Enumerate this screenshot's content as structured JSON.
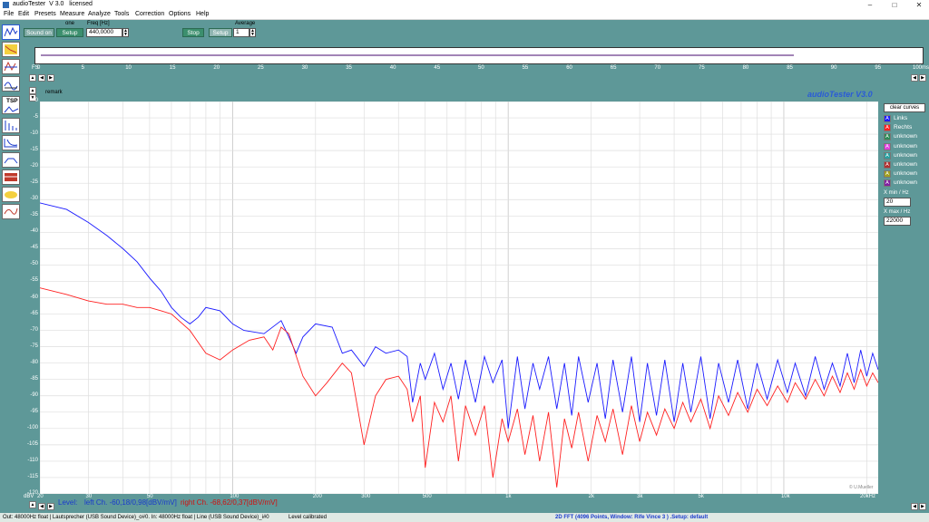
{
  "window": {
    "title": "audioTester  V 3.0   licensed"
  },
  "titlebar_buttons": [
    "–",
    "□",
    "✕"
  ],
  "menu": [
    "File",
    "Edit",
    "Presets",
    "Measure",
    "Analyze",
    "Tools",
    "Correction",
    "Options",
    "Help"
  ],
  "toolbar": {
    "sound_on_label": "Sound on",
    "setup1_label": "Setup",
    "one_label": "one",
    "freq_label": "Freq [Hz]",
    "freq_value": "440,0000",
    "stop_label": "Stop",
    "setup2_label": "Setup",
    "average_label": "Average",
    "average_value": "1"
  },
  "sidebar_icons": [
    "oscilloscope-icon",
    "fft-icon",
    "spectrum-icon",
    "waterfall-icon",
    "sweep-icon",
    "tsp-icon",
    "distortion-icon",
    "impulse-icon",
    "filter-icon",
    "cone-icon",
    "phase-icon"
  ],
  "tsp_label": "TSP",
  "overview": {
    "start_label": "FS",
    "end_label": "100ms",
    "ticks": [
      "0",
      "5",
      "10",
      "15",
      "20",
      "25",
      "30",
      "35",
      "40",
      "45",
      "50",
      "55",
      "60",
      "65",
      "70",
      "75",
      "80",
      "85",
      "90",
      "95"
    ]
  },
  "remark_label": "remark",
  "brand_label": "audioTester  V3.0",
  "copyright_label": "© U.Mueller",
  "legend": {
    "clear_label": "clear curves",
    "items": [
      {
        "letter": "A",
        "label": "Links",
        "color": "#1a1aff"
      },
      {
        "letter": "A",
        "label": "Rechts",
        "color": "#ff2020"
      },
      {
        "letter": "A",
        "label": "unknown",
        "color": "#2e8b57"
      },
      {
        "letter": "A",
        "label": "unknown",
        "color": "#e040e0"
      },
      {
        "letter": "A",
        "label": "unknown",
        "color": "#2aa0a0"
      },
      {
        "letter": "A",
        "label": "unknown",
        "color": "#b03030"
      },
      {
        "letter": "A",
        "label": "unknown",
        "color": "#a0a020"
      },
      {
        "letter": "A",
        "label": "unknown",
        "color": "#8020a0"
      }
    ],
    "xmin_label": "X min / Hz",
    "xmin_value": "20",
    "xmax_label": "X max / Hz",
    "xmax_value": "22000"
  },
  "level": {
    "label": "Level:",
    "left": "left Ch. -60,18/0,98[dBV/mV]",
    "right": "right Ch. -68,62/0,37[dBV/mV]"
  },
  "status": {
    "left": "Out: 48000Hz float  | Lautsprecher (USB Sound Device)_o#0. In: 48000Hz float  | Line (USB Sound Device)_i#0",
    "calibrated": "Level calibrated",
    "center": "2D FFT (4096 Points, Window: Rife Vince 3 )  .Setup:  default"
  },
  "chart_data": {
    "type": "line",
    "yunit": "dBV",
    "xunit": "Hz",
    "xscale": "log",
    "xlim": [
      20,
      22000
    ],
    "ylim": [
      -120,
      0
    ],
    "y_ticks": [
      "0",
      "-5",
      "-10",
      "-15",
      "-20",
      "-25",
      "-30",
      "-35",
      "-40",
      "-45",
      "-50",
      "-55",
      "-60",
      "-65",
      "-70",
      "-75",
      "-80",
      "-85",
      "-90",
      "-95",
      "-100",
      "-105",
      "-110",
      "-115",
      "-120"
    ],
    "x_ticks": [
      {
        "value": 20,
        "label": "20"
      },
      {
        "value": 30,
        "label": "30"
      },
      {
        "value": 50,
        "label": "50"
      },
      {
        "value": 100,
        "label": "100"
      },
      {
        "value": 200,
        "label": "200"
      },
      {
        "value": 300,
        "label": "300"
      },
      {
        "value": 500,
        "label": "500"
      },
      {
        "value": 1000,
        "label": "1k"
      },
      {
        "value": 2000,
        "label": "2k"
      },
      {
        "value": 3000,
        "label": "3k"
      },
      {
        "value": 5000,
        "label": "5k"
      },
      {
        "value": 10000,
        "label": "10k"
      },
      {
        "value": 20000,
        "label": "20kHz"
      }
    ],
    "y_axis_label": "dBV",
    "grid": true,
    "series": [
      {
        "name": "Links",
        "color": "#1a1aff",
        "points": [
          [
            20,
            -31
          ],
          [
            25,
            -33
          ],
          [
            30,
            -37
          ],
          [
            35,
            -41
          ],
          [
            40,
            -45
          ],
          [
            45,
            -49
          ],
          [
            50,
            -54
          ],
          [
            55,
            -58
          ],
          [
            60,
            -63
          ],
          [
            65,
            -66
          ],
          [
            70,
            -68
          ],
          [
            75,
            -66
          ],
          [
            80,
            -63
          ],
          [
            90,
            -64
          ],
          [
            100,
            -68
          ],
          [
            110,
            -70
          ],
          [
            130,
            -71
          ],
          [
            150,
            -67
          ],
          [
            160,
            -72
          ],
          [
            170,
            -77
          ],
          [
            180,
            -72
          ],
          [
            200,
            -68
          ],
          [
            230,
            -69
          ],
          [
            250,
            -77
          ],
          [
            270,
            -76
          ],
          [
            300,
            -81
          ],
          [
            330,
            -75
          ],
          [
            360,
            -77
          ],
          [
            400,
            -76
          ],
          [
            430,
            -78
          ],
          [
            450,
            -92
          ],
          [
            480,
            -80
          ],
          [
            500,
            -85
          ],
          [
            540,
            -77
          ],
          [
            580,
            -88
          ],
          [
            620,
            -80
          ],
          [
            660,
            -91
          ],
          [
            700,
            -79
          ],
          [
            760,
            -92
          ],
          [
            820,
            -78
          ],
          [
            880,
            -86
          ],
          [
            950,
            -79
          ],
          [
            1000,
            -100
          ],
          [
            1080,
            -78
          ],
          [
            1150,
            -94
          ],
          [
            1230,
            -80
          ],
          [
            1300,
            -88
          ],
          [
            1400,
            -78
          ],
          [
            1500,
            -94
          ],
          [
            1600,
            -80
          ],
          [
            1700,
            -96
          ],
          [
            1800,
            -78
          ],
          [
            1950,
            -92
          ],
          [
            2100,
            -80
          ],
          [
            2250,
            -97
          ],
          [
            2400,
            -79
          ],
          [
            2600,
            -95
          ],
          [
            2800,
            -78
          ],
          [
            3000,
            -98
          ],
          [
            3200,
            -80
          ],
          [
            3450,
            -96
          ],
          [
            3700,
            -79
          ],
          [
            4000,
            -98
          ],
          [
            4300,
            -80
          ],
          [
            4600,
            -95
          ],
          [
            5000,
            -78
          ],
          [
            5400,
            -97
          ],
          [
            5800,
            -80
          ],
          [
            6300,
            -92
          ],
          [
            6800,
            -79
          ],
          [
            7400,
            -94
          ],
          [
            8000,
            -80
          ],
          [
            8700,
            -91
          ],
          [
            9500,
            -79
          ],
          [
            10300,
            -89
          ],
          [
            11000,
            -80
          ],
          [
            12000,
            -90
          ],
          [
            13000,
            -78
          ],
          [
            14000,
            -88
          ],
          [
            15000,
            -80
          ],
          [
            16000,
            -87
          ],
          [
            17000,
            -77
          ],
          [
            18000,
            -86
          ],
          [
            19000,
            -76
          ],
          [
            20000,
            -84
          ],
          [
            21000,
            -77
          ],
          [
            22000,
            -82
          ]
        ]
      },
      {
        "name": "Rechts",
        "color": "#ff2020",
        "points": [
          [
            20,
            -57
          ],
          [
            25,
            -59
          ],
          [
            30,
            -61
          ],
          [
            35,
            -62
          ],
          [
            40,
            -62
          ],
          [
            45,
            -63
          ],
          [
            50,
            -63
          ],
          [
            55,
            -64
          ],
          [
            60,
            -65
          ],
          [
            70,
            -70
          ],
          [
            80,
            -77
          ],
          [
            90,
            -79
          ],
          [
            100,
            -76
          ],
          [
            115,
            -73
          ],
          [
            130,
            -72
          ],
          [
            140,
            -76
          ],
          [
            150,
            -69
          ],
          [
            160,
            -71
          ],
          [
            180,
            -84
          ],
          [
            200,
            -90
          ],
          [
            220,
            -86
          ],
          [
            250,
            -80
          ],
          [
            270,
            -83
          ],
          [
            300,
            -105
          ],
          [
            330,
            -90
          ],
          [
            360,
            -85
          ],
          [
            400,
            -84
          ],
          [
            430,
            -88
          ],
          [
            450,
            -98
          ],
          [
            480,
            -90
          ],
          [
            500,
            -112
          ],
          [
            540,
            -92
          ],
          [
            580,
            -98
          ],
          [
            620,
            -90
          ],
          [
            660,
            -110
          ],
          [
            700,
            -93
          ],
          [
            760,
            -102
          ],
          [
            820,
            -93
          ],
          [
            880,
            -115
          ],
          [
            950,
            -97
          ],
          [
            1000,
            -104
          ],
          [
            1080,
            -94
          ],
          [
            1150,
            -108
          ],
          [
            1230,
            -96
          ],
          [
            1300,
            -110
          ],
          [
            1400,
            -95
          ],
          [
            1500,
            -118
          ],
          [
            1600,
            -97
          ],
          [
            1700,
            -106
          ],
          [
            1800,
            -95
          ],
          [
            1950,
            -110
          ],
          [
            2100,
            -96
          ],
          [
            2250,
            -104
          ],
          [
            2400,
            -94
          ],
          [
            2600,
            -108
          ],
          [
            2800,
            -93
          ],
          [
            3000,
            -104
          ],
          [
            3200,
            -95
          ],
          [
            3450,
            -102
          ],
          [
            3700,
            -94
          ],
          [
            4000,
            -100
          ],
          [
            4300,
            -92
          ],
          [
            4600,
            -98
          ],
          [
            5000,
            -91
          ],
          [
            5400,
            -100
          ],
          [
            5800,
            -90
          ],
          [
            6300,
            -96
          ],
          [
            6800,
            -89
          ],
          [
            7400,
            -95
          ],
          [
            8000,
            -88
          ],
          [
            8700,
            -93
          ],
          [
            9500,
            -87
          ],
          [
            10300,
            -92
          ],
          [
            11000,
            -86
          ],
          [
            12000,
            -91
          ],
          [
            13000,
            -85
          ],
          [
            14000,
            -90
          ],
          [
            15000,
            -84
          ],
          [
            16000,
            -89
          ],
          [
            17000,
            -83
          ],
          [
            18000,
            -88
          ],
          [
            19000,
            -82
          ],
          [
            20000,
            -87
          ],
          [
            21000,
            -83
          ],
          [
            22000,
            -86
          ]
        ]
      }
    ]
  }
}
